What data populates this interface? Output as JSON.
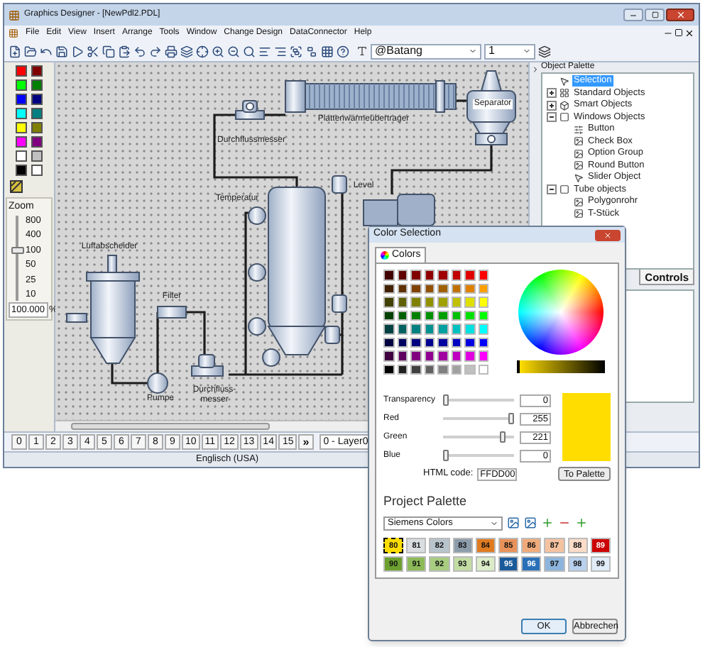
{
  "window": {
    "title": "Graphics Designer - [NewPdl2.PDL]"
  },
  "menu": [
    "File",
    "Edit",
    "View",
    "Insert",
    "Arrange",
    "Tools",
    "Window",
    "Change Design",
    "DataConnector",
    "Help"
  ],
  "toolbar": {
    "font": "@Batang",
    "size": "1"
  },
  "color_palette": [
    [
      {
        "color": "#ff0000"
      },
      {
        "color": "#800000"
      }
    ],
    [
      {
        "color": "#00ff00"
      },
      {
        "color": "#008000"
      }
    ],
    [
      {
        "color": "#0000ff"
      },
      {
        "color": "#000080"
      }
    ],
    [
      {
        "color": "#00ffff"
      },
      {
        "color": "#008080"
      }
    ],
    [
      {
        "color": "#ffff00"
      },
      {
        "color": "#808000"
      }
    ],
    [
      {
        "color": "#ff00ff"
      },
      {
        "color": "#800080"
      }
    ],
    [
      {
        "color": "#ffffff"
      },
      {
        "color": "#c0c0c0"
      }
    ],
    [
      {
        "color": "#000000"
      },
      {
        "color": "#ffffff"
      }
    ]
  ],
  "zoom": {
    "title": "Zoom",
    "ticks": [
      "800",
      "400",
      "100",
      "50",
      "25",
      "10"
    ],
    "level": 0.6,
    "value": "100.000",
    "unit": "%"
  },
  "diagram": {
    "labels": [
      "Durchflussmesser",
      "Plattenwärmeübertrager",
      "Separator",
      "Temperatur",
      "Level",
      "Luftabscheider",
      "Filter",
      "Pumpe",
      "Durchfluss-messer"
    ]
  },
  "object_palette": {
    "title": "Object Palette",
    "items": [
      {
        "label": "Selection",
        "selected": true
      },
      {
        "label": "Standard Objects",
        "selected": false,
        "expanded": false
      },
      {
        "label": "Smart Objects",
        "selected": false,
        "expanded": false
      },
      {
        "label": "Windows Objects",
        "selected": false,
        "expanded": true,
        "children": [
          {
            "label": "Button",
            "selected": false
          },
          {
            "label": "Check Box",
            "selected": false
          },
          {
            "label": "Option Group",
            "selected": false
          },
          {
            "label": "Round Button",
            "selected": false
          },
          {
            "label": "Slider Object",
            "selected": false
          }
        ]
      },
      {
        "label": "Tube objects",
        "selected": false,
        "expanded": true,
        "children": [
          {
            "label": "Polygonrohr",
            "selected": false
          },
          {
            "label": "T-Stück",
            "selected": false
          }
        ]
      }
    ],
    "tabs": [
      "Controls"
    ]
  },
  "layers": {
    "tabs": [
      "0",
      "1",
      "2",
      "3",
      "4",
      "5",
      "6",
      "7",
      "8",
      "9",
      "10",
      "11",
      "12",
      "13",
      "14",
      "15"
    ],
    "more": "»",
    "layer": "0 - Layer0"
  },
  "status_bar": {
    "language": "Englisch (USA)"
  },
  "color_dialog": {
    "title": "Color Selection",
    "tabs": [
      {
        "label": "Colors",
        "selected": true
      }
    ],
    "basic_colors": [
      [
        {
          "color": "#400000"
        },
        {
          "color": "#600000"
        },
        {
          "color": "#800000"
        },
        {
          "color": "#900000"
        },
        {
          "color": "#a00000"
        },
        {
          "color": "#c00000"
        },
        {
          "color": "#e00000"
        },
        {
          "color": "#ff0000"
        }
      ],
      [
        {
          "color": "#402000"
        },
        {
          "color": "#603000"
        },
        {
          "color": "#804000"
        },
        {
          "color": "#905000"
        },
        {
          "color": "#a06000"
        },
        {
          "color": "#c07000"
        },
        {
          "color": "#e08000"
        },
        {
          "color": "#ffa000"
        }
      ],
      [
        {
          "color": "#404000"
        },
        {
          "color": "#606000"
        },
        {
          "color": "#808000"
        },
        {
          "color": "#909000"
        },
        {
          "color": "#a0a000"
        },
        {
          "color": "#c0c000"
        },
        {
          "color": "#e0e000"
        },
        {
          "color": "#ffff00"
        }
      ],
      [
        {
          "color": "#004000"
        },
        {
          "color": "#006000"
        },
        {
          "color": "#008000"
        },
        {
          "color": "#009000"
        },
        {
          "color": "#00a000"
        },
        {
          "color": "#00c000"
        },
        {
          "color": "#00e000"
        },
        {
          "color": "#00ff00"
        }
      ],
      [
        {
          "color": "#004040"
        },
        {
          "color": "#006060"
        },
        {
          "color": "#008080"
        },
        {
          "color": "#009090"
        },
        {
          "color": "#00a0a0"
        },
        {
          "color": "#00c0c0"
        },
        {
          "color": "#00e0e0"
        },
        {
          "color": "#00ffff"
        }
      ],
      [
        {
          "color": "#000040"
        },
        {
          "color": "#000060"
        },
        {
          "color": "#000080"
        },
        {
          "color": "#000090"
        },
        {
          "color": "#0000a0"
        },
        {
          "color": "#0000c0"
        },
        {
          "color": "#0000e0"
        },
        {
          "color": "#0000ff"
        }
      ],
      [
        {
          "color": "#400040"
        },
        {
          "color": "#600060"
        },
        {
          "color": "#800080"
        },
        {
          "color": "#900090"
        },
        {
          "color": "#a000a0"
        },
        {
          "color": "#c000c0"
        },
        {
          "color": "#e000e0"
        },
        {
          "color": "#ff00ff"
        }
      ],
      [
        {
          "color": "#000000"
        },
        {
          "color": "#202020"
        },
        {
          "color": "#404040"
        },
        {
          "color": "#606060"
        },
        {
          "color": "#808080"
        },
        {
          "color": "#a0a0a0"
        },
        {
          "color": "#c0c0c0"
        },
        {
          "color": "#ffffff"
        }
      ]
    ],
    "sliders": [
      {
        "label": "Transparency",
        "level": 0,
        "value": "0"
      },
      {
        "label": "Red",
        "level": 1,
        "value": "255"
      },
      {
        "label": "Green",
        "level": 0.87,
        "value": "221"
      },
      {
        "label": "Blue",
        "level": 0,
        "value": "0"
      }
    ],
    "preview": {
      "color": "#ffdd00"
    },
    "html_code_label": "HTML code:",
    "html_code": "FFDD00",
    "to_palette": "To Palette",
    "project_palette": {
      "title": "Project Palette",
      "palette": "Siemens Colors",
      "swatches": [
        {
          "label": "80",
          "color": "#ffdd00",
          "selected": true
        },
        {
          "label": "81",
          "color": "#d9dde0",
          "selected": false
        },
        {
          "label": "82",
          "color": "#b8c4cc",
          "selected": false
        },
        {
          "label": "83",
          "color": "#8c9cab",
          "selected": false
        },
        {
          "label": "84",
          "color": "#e07b20",
          "selected": false
        },
        {
          "label": "85",
          "color": "#e8925a",
          "selected": false
        },
        {
          "label": "86",
          "color": "#f0aa7a",
          "selected": false
        },
        {
          "label": "87",
          "color": "#f5c2a0",
          "selected": false
        },
        {
          "label": "88",
          "color": "#fadcc8",
          "selected": false
        },
        {
          "label": "89",
          "color": "#cc0000",
          "selected": false
        },
        {
          "label": "90",
          "color": "#6ca030",
          "selected": false
        },
        {
          "label": "91",
          "color": "#8cba58",
          "selected": false
        },
        {
          "label": "92",
          "color": "#a8cc80",
          "selected": false
        },
        {
          "label": "93",
          "color": "#c2dca4",
          "selected": false
        },
        {
          "label": "94",
          "color": "#dcecc8",
          "selected": false
        },
        {
          "label": "95",
          "color": "#1a5a9a",
          "selected": false
        },
        {
          "label": "96",
          "color": "#2a70b8",
          "selected": false
        },
        {
          "label": "97",
          "color": "#8cb4dc",
          "selected": false
        },
        {
          "label": "98",
          "color": "#b8d0ec",
          "selected": false
        },
        {
          "label": "99",
          "color": "#e0ecf8",
          "selected": false
        }
      ]
    },
    "buttons": [
      "OK",
      "Abbrechen"
    ]
  }
}
